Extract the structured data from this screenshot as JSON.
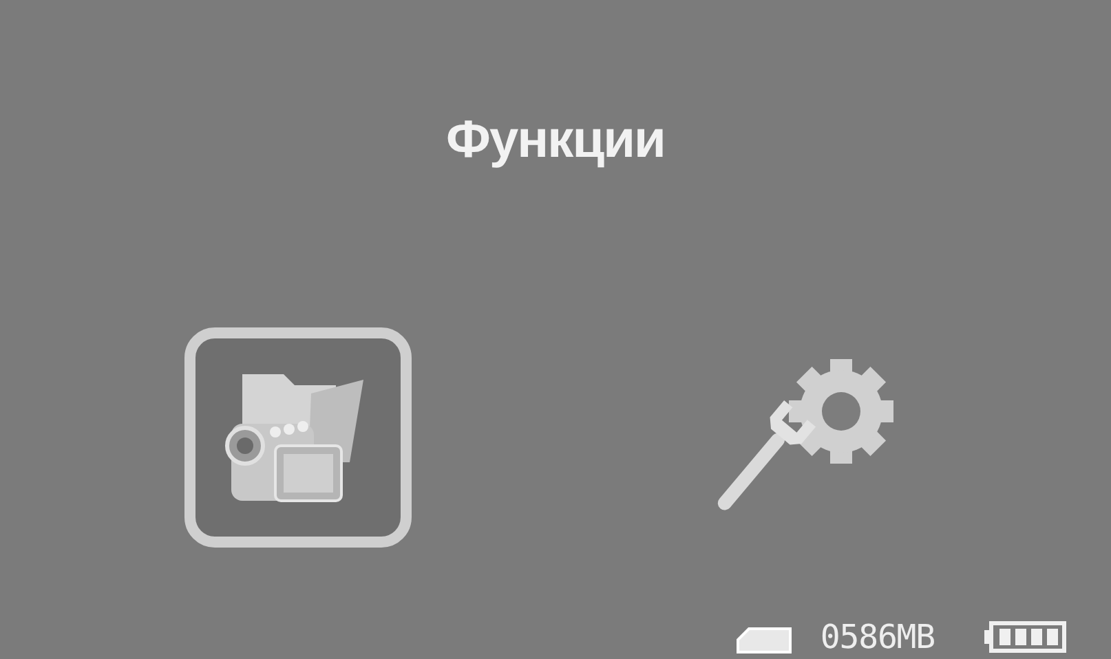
{
  "title": "Функции",
  "menu_items": [
    {
      "kind": "video",
      "selected": true
    },
    {
      "kind": "settings",
      "selected": false
    }
  ],
  "status_bar": {
    "storage": "0586MB"
  }
}
